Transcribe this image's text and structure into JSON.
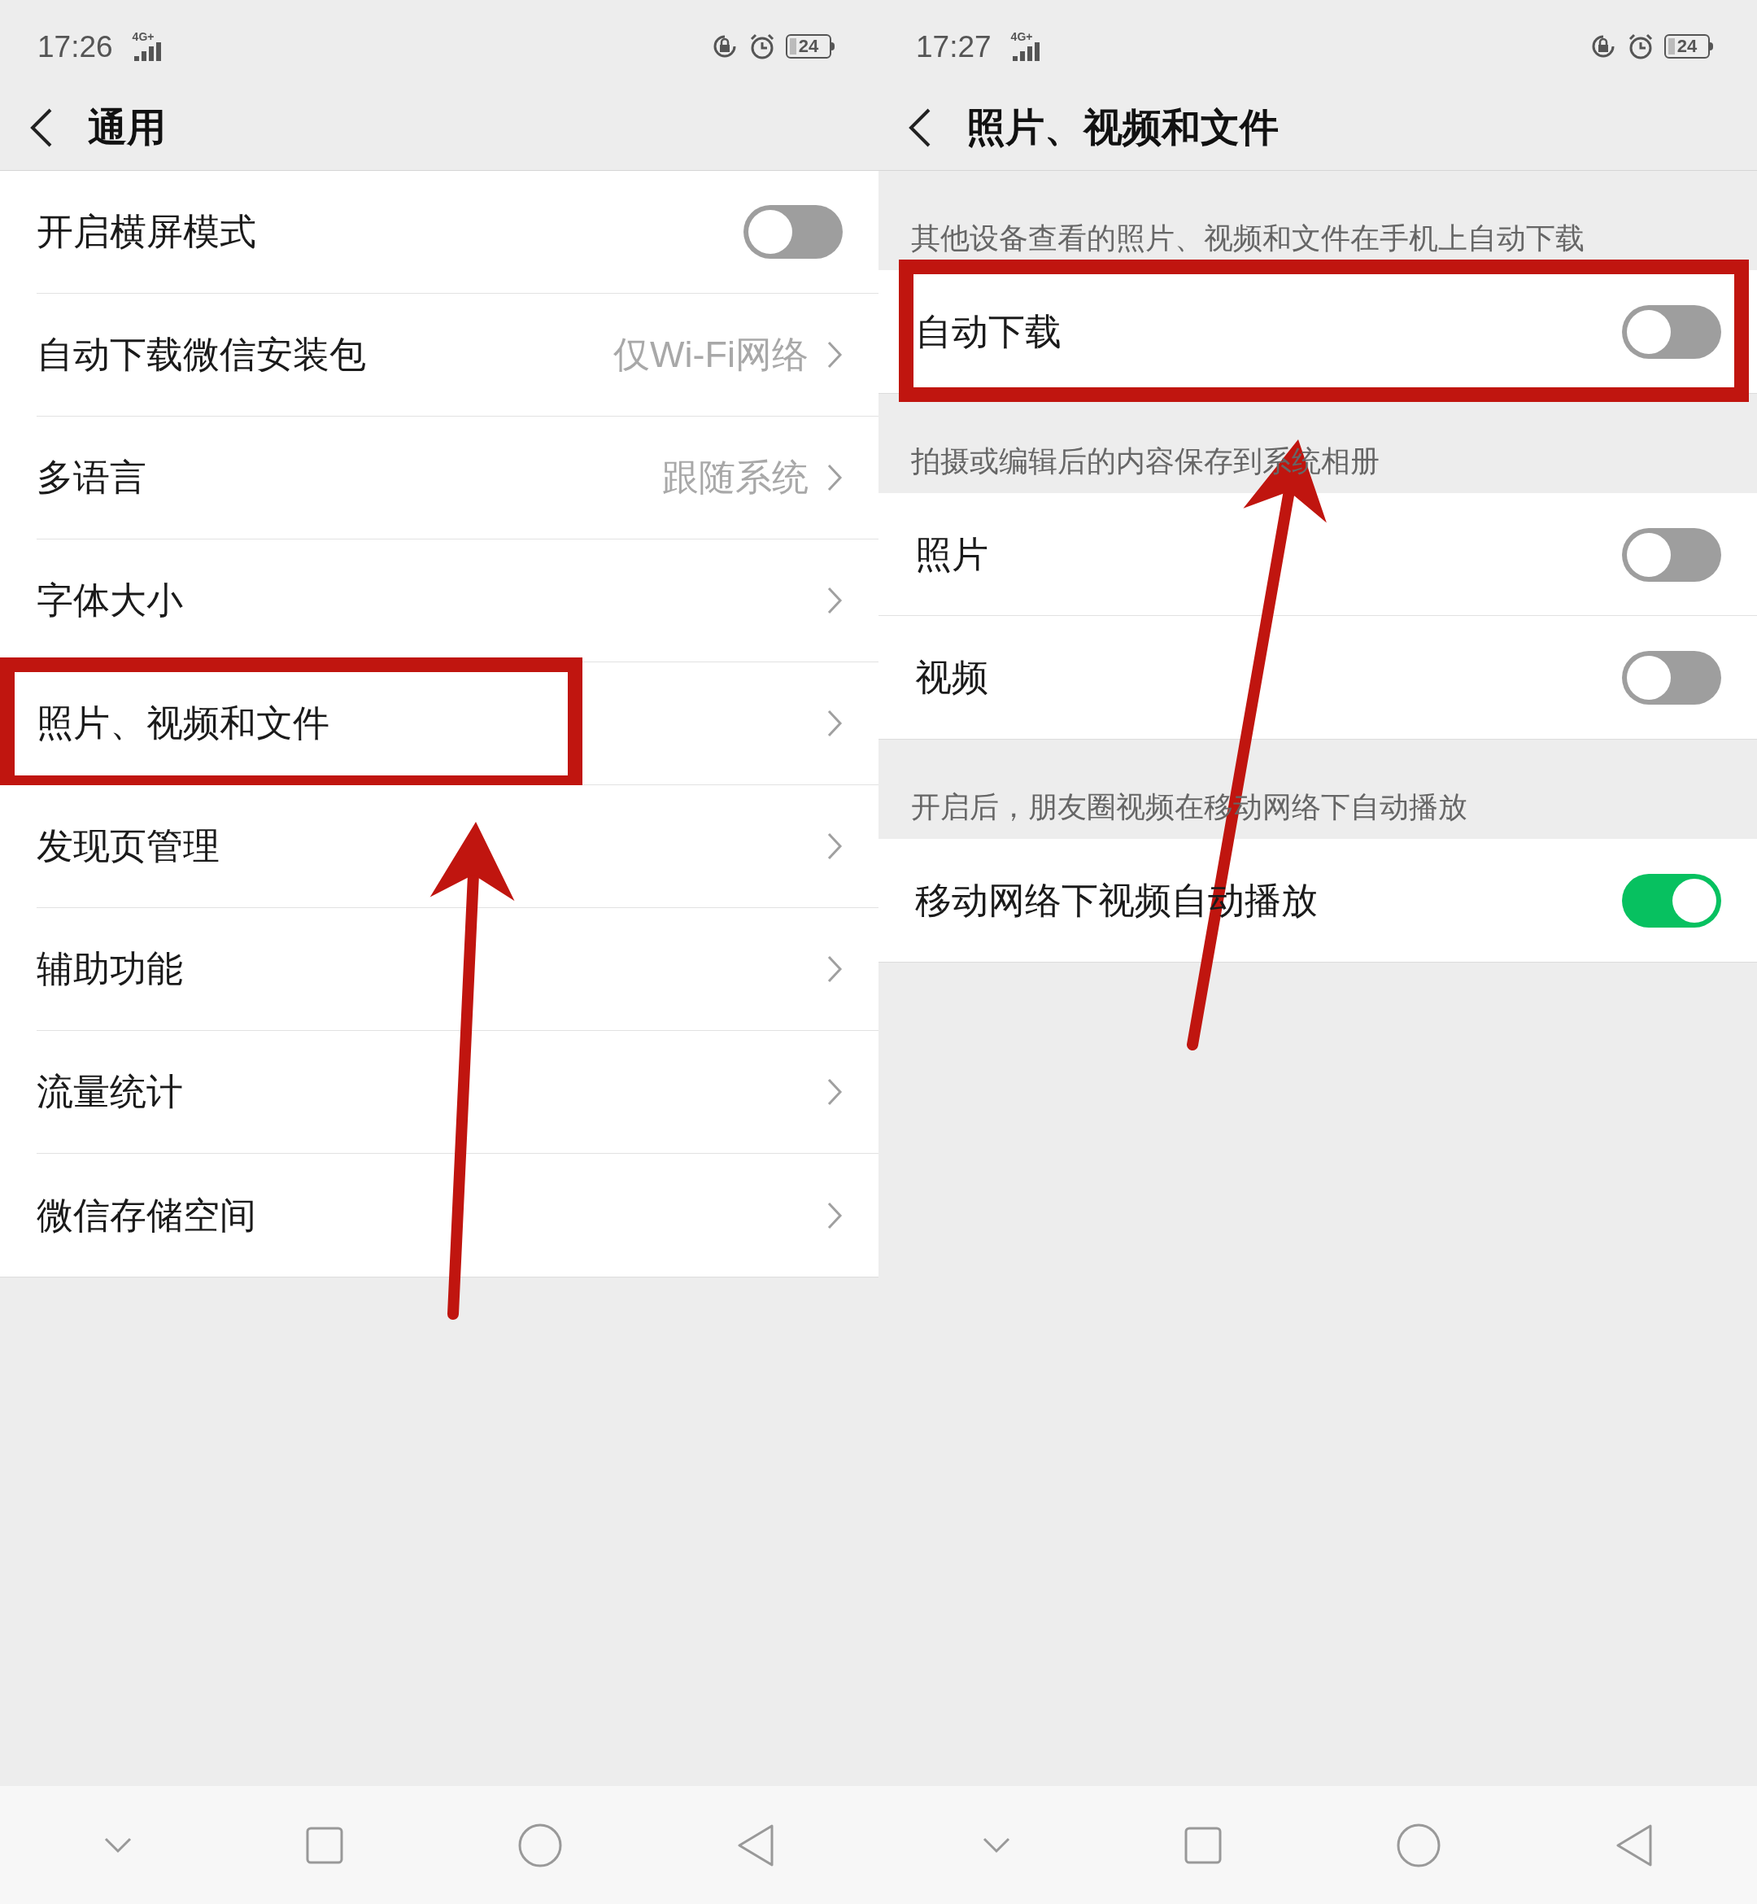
{
  "panels": [
    {
      "status_bar": {
        "time": "17:26",
        "network": "4G+",
        "battery": "24"
      },
      "header": {
        "title": "通用"
      },
      "arrow": true,
      "sections": [
        {
          "items": [
            {
              "label": "开启横屏模式",
              "kind": "toggle",
              "on": false,
              "highlighted": false
            },
            {
              "label": "自动下载微信安装包",
              "kind": "link",
              "value": "仅Wi-Fi网络",
              "highlighted": false
            },
            {
              "label": "多语言",
              "kind": "link",
              "value": "跟随系统",
              "highlighted": false
            },
            {
              "label": "字体大小",
              "kind": "link",
              "highlighted": false
            },
            {
              "label": "照片、视频和文件",
              "kind": "link",
              "highlighted": true
            },
            {
              "label": "发现页管理",
              "kind": "link",
              "highlighted": false
            },
            {
              "label": "辅助功能",
              "kind": "link",
              "highlighted": false
            },
            {
              "label": "流量统计",
              "kind": "link",
              "highlighted": false
            },
            {
              "label": "微信存储空间",
              "kind": "link",
              "highlighted": false
            }
          ]
        }
      ]
    },
    {
      "status_bar": {
        "time": "17:27",
        "network": "4G+",
        "battery": "24"
      },
      "header": {
        "title": "照片、视频和文件"
      },
      "arrow": true,
      "sections": [
        {
          "caption": "其他设备查看的照片、视频和文件在手机上自动下载",
          "items": [
            {
              "label": "自动下载",
              "kind": "toggle",
              "on": false,
              "highlighted": true
            }
          ]
        },
        {
          "caption": "拍摄或编辑后的内容保存到系统相册",
          "items": [
            {
              "label": "照片",
              "kind": "toggle",
              "on": false,
              "highlighted": false
            },
            {
              "label": "视频",
              "kind": "toggle",
              "on": false,
              "highlighted": false
            }
          ]
        },
        {
          "caption": "开启后，朋友圈视频在移动网络下自动播放",
          "items": [
            {
              "label": "移动网络下视频自动播放",
              "kind": "toggle",
              "on": true,
              "highlighted": false
            }
          ]
        }
      ]
    }
  ]
}
